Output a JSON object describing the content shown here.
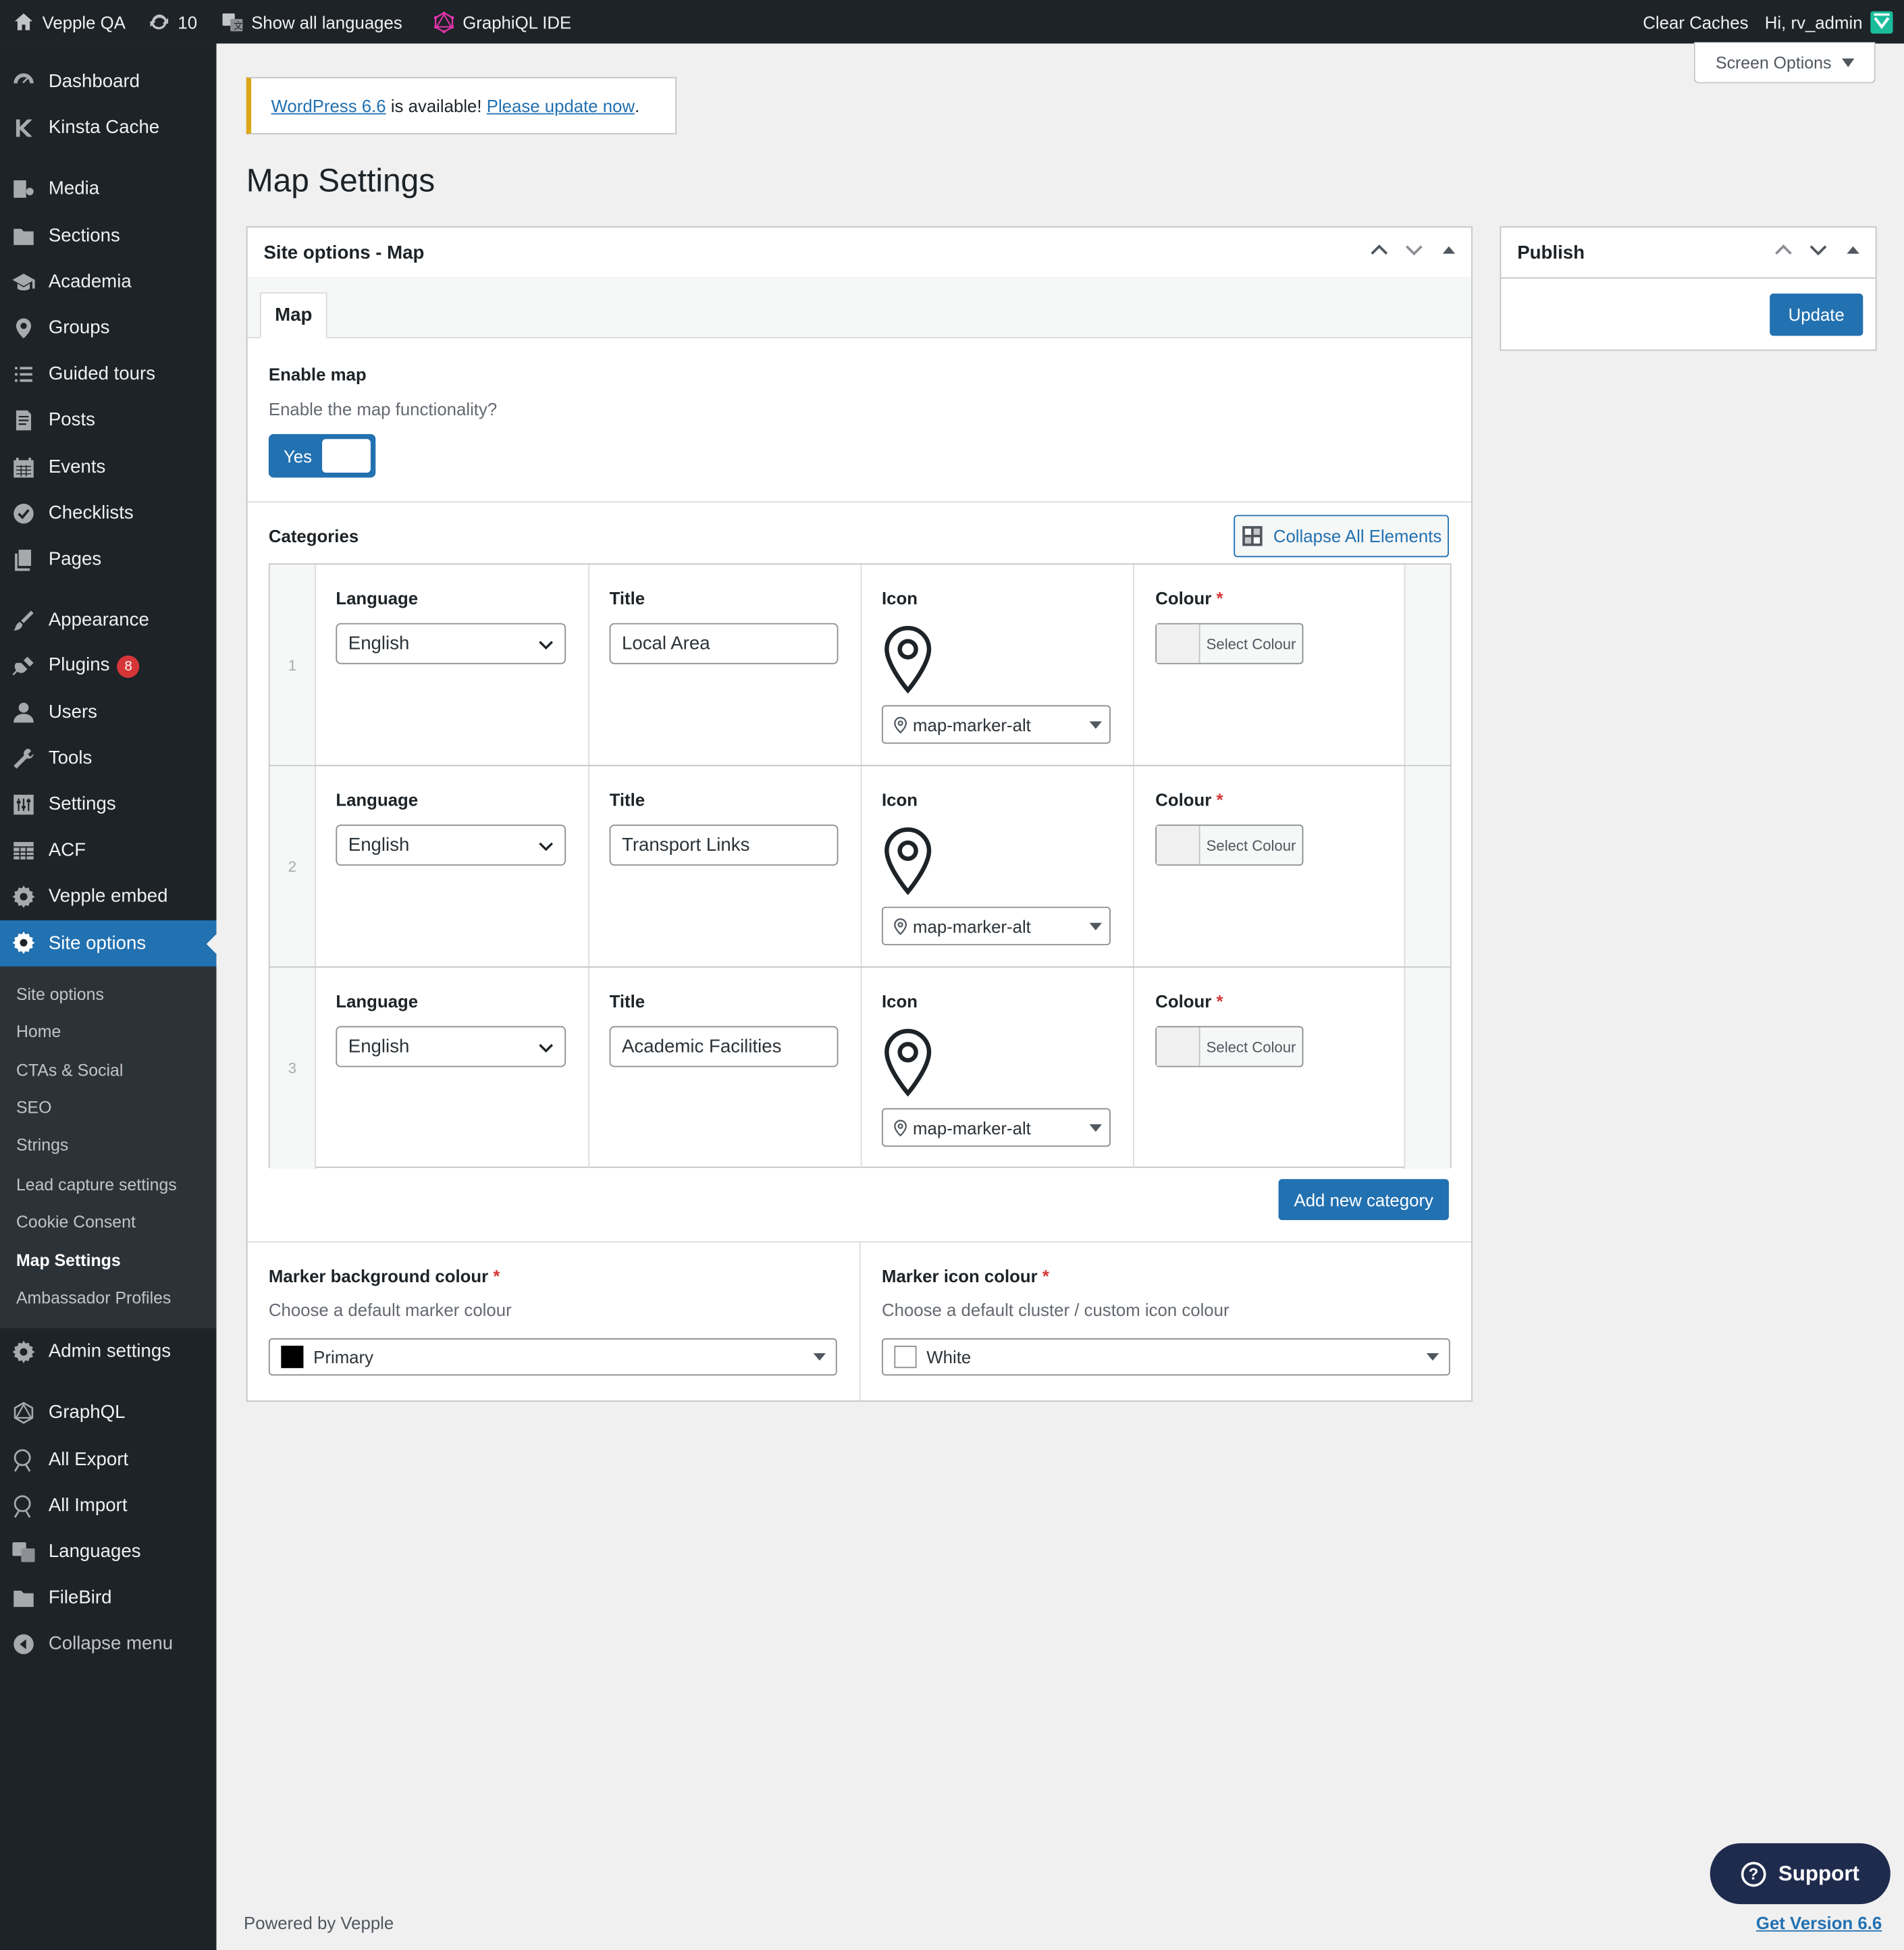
{
  "adminbar": {
    "site_name": "Vepple QA",
    "updates_count": "10",
    "languages": "Show all languages",
    "graphiql": "GraphiQL IDE",
    "clear_caches": "Clear Caches",
    "greeting": "Hi, rv_admin"
  },
  "sidebar": {
    "items": [
      {
        "label": "Dashboard",
        "icon": "dashboard-icon"
      },
      {
        "label": "Kinsta Cache",
        "icon": "kinsta-icon"
      },
      {
        "label": "Media",
        "icon": "media-icon"
      },
      {
        "label": "Sections",
        "icon": "folder-icon"
      },
      {
        "label": "Academia",
        "icon": "academia-icon"
      },
      {
        "label": "Groups",
        "icon": "location-icon"
      },
      {
        "label": "Guided tours",
        "icon": "list-icon"
      },
      {
        "label": "Posts",
        "icon": "posts-icon"
      },
      {
        "label": "Events",
        "icon": "calendar-icon"
      },
      {
        "label": "Checklists",
        "icon": "checkmark-icon"
      },
      {
        "label": "Pages",
        "icon": "pages-icon"
      },
      {
        "label": "Appearance",
        "icon": "brush-icon"
      },
      {
        "label": "Plugins",
        "icon": "plugin-icon",
        "badge": "8"
      },
      {
        "label": "Users",
        "icon": "user-icon"
      },
      {
        "label": "Tools",
        "icon": "wrench-icon"
      },
      {
        "label": "Settings",
        "icon": "settings-icon"
      },
      {
        "label": "ACF",
        "icon": "table-icon"
      },
      {
        "label": "Vepple embed",
        "icon": "gear-icon"
      },
      {
        "label": "Site options",
        "icon": "gear-icon",
        "current": true
      },
      {
        "label": "Admin settings",
        "icon": "gear-icon"
      },
      {
        "label": "GraphQL",
        "icon": "graphql-icon"
      },
      {
        "label": "All Export",
        "icon": "export-icon"
      },
      {
        "label": "All Import",
        "icon": "import-icon"
      },
      {
        "label": "Languages",
        "icon": "translate-icon"
      },
      {
        "label": "FileBird",
        "icon": "folder-icon"
      },
      {
        "label": "Collapse menu",
        "icon": "collapse-icon"
      }
    ],
    "submenu": [
      "Site options",
      "Home",
      "CTAs & Social",
      "SEO",
      "Strings",
      "Lead capture settings",
      "Cookie Consent",
      "Map Settings",
      "Ambassador Profiles"
    ],
    "submenu_current": "Map Settings"
  },
  "notice": {
    "link1": "WordPress 6.6",
    "middle": " is available! ",
    "link2": "Please update now",
    "end": "."
  },
  "screen_options": "Screen Options",
  "page_title": "Map Settings",
  "main_box": {
    "title": "Site options - Map",
    "tab": "Map",
    "enable_map_label": "Enable map",
    "enable_map_desc": "Enable the map functionality?",
    "toggle_label": "Yes",
    "categories_label": "Categories",
    "collapse_btn": "Collapse All Elements",
    "columns": {
      "language": "Language",
      "title": "Title",
      "icon": "Icon",
      "colour": "Colour"
    },
    "required_mark": "*",
    "rows": [
      {
        "num": "1",
        "language": "English",
        "title": "Local Area",
        "icon": "map-marker-alt",
        "colour_btn": "Select Colour"
      },
      {
        "num": "2",
        "language": "English",
        "title": "Transport Links",
        "icon": "map-marker-alt",
        "colour_btn": "Select Colour"
      },
      {
        "num": "3",
        "language": "English",
        "title": "Academic Facilities",
        "icon": "map-marker-alt",
        "colour_btn": "Select Colour"
      }
    ],
    "add_btn": "Add new category",
    "marker_bg_label": "Marker background colour",
    "marker_bg_desc": "Choose a default marker colour",
    "marker_bg_value": "Primary",
    "marker_bg_colour": "#000000",
    "marker_icon_label": "Marker icon colour",
    "marker_icon_desc": "Choose a default cluster / custom icon colour",
    "marker_icon_value": "White",
    "marker_icon_colour": "#ffffff"
  },
  "publish": {
    "title": "Publish",
    "update_btn": "Update"
  },
  "support_btn": "Support",
  "footer": {
    "left": "Powered by Vepple",
    "right": "Get Version 6.6"
  },
  "colors": {
    "accent": "#2271b1",
    "adminbar_bg": "#1d2327",
    "notice_border": "#dba617",
    "required": "#d63638",
    "support_bg": "#1f2b4d"
  }
}
